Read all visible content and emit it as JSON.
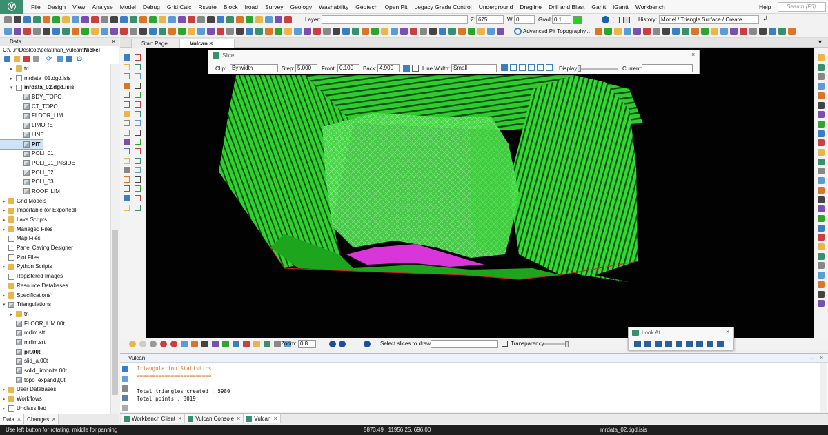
{
  "menu": {
    "logo": "Ⓥ",
    "items": [
      "File",
      "Design",
      "View",
      "Analyse",
      "Model",
      "Debug",
      "Grid Calc",
      "Rsvute",
      "Block",
      "Iroad",
      "Survey",
      "Geology",
      "Washability",
      "Geotech",
      "Open Pit",
      "Legacy Grade Control",
      "Underground",
      "Dragline",
      "Drill and Blast",
      "Gantt",
      "iGantt",
      "Workbench"
    ],
    "help": "Help",
    "search_placeholder": "Search (F3)"
  },
  "toolbar1": {
    "layer_label": "Layer:",
    "layer_value": "",
    "z_label": "Z:",
    "z_value": "675",
    "w_label": "W:",
    "w_value": "0",
    "grad_label": "Grad:",
    "grad_value": "0:1",
    "history_label": "History:",
    "history_value": "Model / Triangle Surface / Create..."
  },
  "toolbar2": {
    "advanced_pit_label": "Advanced Pit Topography..."
  },
  "left_panel": {
    "title": "Data",
    "path_prefix": "C:\\...n\\Desktop\\pelatihan_vulcan\\",
    "path_bold": "Nickel",
    "tree": [
      {
        "label": "tri",
        "indent": 1,
        "icon": "folder",
        "arrow": "▸",
        "bold": false
      },
      {
        "label": "mrdata_01.dgd.isis",
        "indent": 1,
        "icon": "file",
        "arrow": "▸",
        "bold": false
      },
      {
        "label": "mrdata_02.dgd.isis",
        "indent": 1,
        "icon": "file",
        "arrow": "▾",
        "bold": true
      },
      {
        "label": "BDY_TOPO",
        "indent": 2,
        "icon": "tri",
        "arrow": "",
        "bold": false
      },
      {
        "label": "CT_TOPO",
        "indent": 2,
        "icon": "tri",
        "arrow": "",
        "bold": false
      },
      {
        "label": "FLOOR_LIM",
        "indent": 2,
        "icon": "tri",
        "arrow": "",
        "bold": false
      },
      {
        "label": "LIMORE",
        "indent": 2,
        "icon": "tri",
        "arrow": "",
        "bold": false
      },
      {
        "label": "LINE",
        "indent": 2,
        "icon": "tri",
        "arrow": "",
        "bold": false
      },
      {
        "label": "PIT",
        "indent": 2,
        "icon": "tri",
        "arrow": "",
        "bold": true,
        "selected": true
      },
      {
        "label": "POLI_01",
        "indent": 2,
        "icon": "tri",
        "arrow": "",
        "bold": false
      },
      {
        "label": "POLI_01_INSIDE",
        "indent": 2,
        "icon": "tri",
        "arrow": "",
        "bold": false
      },
      {
        "label": "POLI_02",
        "indent": 2,
        "icon": "tri",
        "arrow": "",
        "bold": false
      },
      {
        "label": "POLI_03",
        "indent": 2,
        "icon": "tri",
        "arrow": "",
        "bold": false
      },
      {
        "label": "ROOF_LIM",
        "indent": 2,
        "icon": "tri",
        "arrow": "",
        "bold": false
      },
      {
        "label": "Grid Models",
        "indent": 0,
        "icon": "folder",
        "arrow": "▸",
        "bold": false
      },
      {
        "label": "Importable (or Exported)",
        "indent": 0,
        "icon": "folder",
        "arrow": "▸",
        "bold": false
      },
      {
        "label": "Lava Scripts",
        "indent": 0,
        "icon": "folder",
        "arrow": "▸",
        "bold": false
      },
      {
        "label": "Managed Files",
        "indent": 0,
        "icon": "folder",
        "arrow": "▸",
        "bold": false
      },
      {
        "label": "Map Files",
        "indent": 0,
        "icon": "file",
        "arrow": "",
        "bold": false
      },
      {
        "label": "Panel Caving Designer",
        "indent": 0,
        "icon": "file",
        "arrow": "",
        "bold": false
      },
      {
        "label": "Plot Files",
        "indent": 0,
        "icon": "file",
        "arrow": "",
        "bold": false
      },
      {
        "label": "Python Scripts",
        "indent": 0,
        "icon": "folder",
        "arrow": "▸",
        "bold": false
      },
      {
        "label": "Registered Images",
        "indent": 0,
        "icon": "file",
        "arrow": "",
        "bold": false
      },
      {
        "label": "Resource Databases",
        "indent": 0,
        "icon": "folder",
        "arrow": "",
        "bold": false
      },
      {
        "label": "Specifications",
        "indent": 0,
        "icon": "folder",
        "arrow": "▸",
        "bold": false
      },
      {
        "label": "Triangulations",
        "indent": 0,
        "icon": "tri",
        "arrow": "▾",
        "bold": false
      },
      {
        "label": "tri",
        "indent": 1,
        "icon": "folder",
        "arrow": "▸",
        "bold": false
      },
      {
        "label": "FLOOR_LIM.00t",
        "indent": 1,
        "icon": "tri",
        "arrow": "",
        "bold": false
      },
      {
        "label": "mrlim.sft",
        "indent": 1,
        "icon": "tri",
        "arrow": "",
        "bold": false
      },
      {
        "label": "mrlim.srt",
        "indent": 1,
        "icon": "tri",
        "arrow": "",
        "bold": false
      },
      {
        "label": "pit.00t",
        "indent": 1,
        "icon": "tri",
        "arrow": "",
        "bold": true
      },
      {
        "label": "slid_a.00t",
        "indent": 1,
        "icon": "tri",
        "arrow": "",
        "bold": false
      },
      {
        "label": "solid_limonite.00t",
        "indent": 1,
        "icon": "tri",
        "arrow": "",
        "bold": false
      },
      {
        "label": "topo_expand.00t",
        "indent": 1,
        "icon": "tri",
        "arrow": "",
        "bold": false,
        "hover": true
      },
      {
        "label": "User Databases",
        "indent": 0,
        "icon": "folder",
        "arrow": "▸",
        "bold": false
      },
      {
        "label": "Workflows",
        "indent": 0,
        "icon": "folder",
        "arrow": "▸",
        "bold": false
      },
      {
        "label": "Unclassified",
        "indent": 0,
        "icon": "file",
        "arrow": "▸",
        "bold": false
      }
    ],
    "bottom_tabs": [
      "Data",
      "Changes"
    ]
  },
  "doc_tabs": [
    "Start Page",
    "Vulcan"
  ],
  "slice_panel": {
    "title": "Slice",
    "clip_label": "Clip:",
    "clip_value": "By width",
    "step_label": "Step:",
    "step_value": "5.000",
    "front_label": "Front:",
    "front_value": "0.100",
    "back_label": "Back:",
    "back_value": "4.900",
    "line_width_label": "Line Width:",
    "line_width_value": "Small",
    "display_label": "Display",
    "current_label": "Current:",
    "current_value": ""
  },
  "view_toolbar": {
    "zoom_label": "Zoom:",
    "zoom_value": "0.8",
    "select_slices_label": "Select slices to draw:",
    "transparency_label": "Transparency"
  },
  "look_at": {
    "title": "Look At"
  },
  "console": {
    "title": "Vulcan",
    "lines": [
      {
        "text": "Triangulation Statistics",
        "cls": "orange"
      },
      {
        "text": "========================",
        "cls": "orange"
      },
      {
        "text": "",
        "cls": ""
      },
      {
        "text": "Total triangles created : 5980",
        "cls": ""
      },
      {
        "text": "Total points : 3019",
        "cls": ""
      }
    ]
  },
  "bottom_doc_tabs": [
    "Workbench Client",
    "Vulcan Console",
    "Vulcan"
  ],
  "status": {
    "hint": "Use left button for rotating, middle for panning",
    "coords": "5873.49 , 11956.25, 696.00",
    "file": "mrdata_02.dgd.isis"
  },
  "colors": {
    "pit_green": "#2fd12f",
    "pit_dark": "#0a5a0a",
    "mesh": "#7cff7c",
    "magenta": "#ff40ff",
    "accent": "#3a8f6e"
  }
}
